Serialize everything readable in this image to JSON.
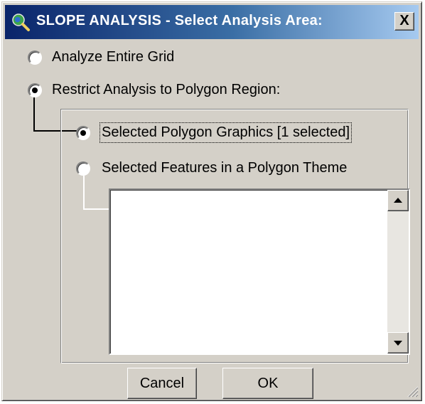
{
  "window": {
    "title": "SLOPE ANALYSIS - Select Analysis Area:",
    "close_symbol": "X",
    "title_icon": "magnifier-globe-icon"
  },
  "options": {
    "entire_grid": {
      "label": "Analyze Entire Grid",
      "checked": false
    },
    "restrict_polygon": {
      "label": "Restrict Analysis to Polygon Region:",
      "checked": true
    }
  },
  "polygon_group": {
    "graphics": {
      "label": "Selected Polygon Graphics [1 selected]",
      "checked": true
    },
    "features": {
      "label": "Selected Features in a Polygon Theme",
      "checked": false
    },
    "theme_list": []
  },
  "buttons": {
    "cancel": "Cancel",
    "ok": "OK"
  },
  "colors": {
    "dialog_face": "#d4d0c8",
    "title_start": "#0a246a",
    "title_end": "#a6caf0"
  }
}
